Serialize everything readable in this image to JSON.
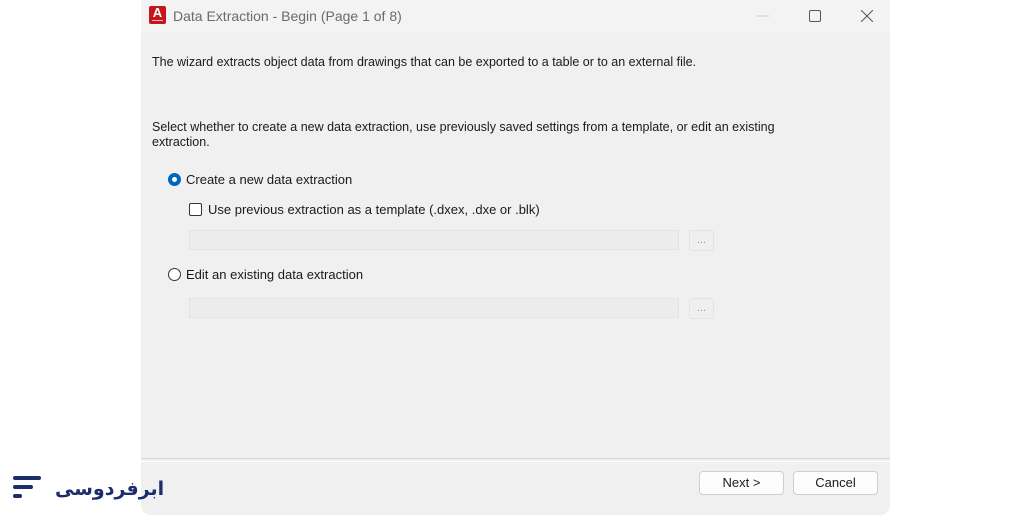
{
  "window": {
    "title": "Data Extraction - Begin (Page 1 of 8)",
    "app_icon_letter": "A"
  },
  "content": {
    "intro": "The wizard extracts object data from drawings that can be exported to a table or to an external file.",
    "instruction": "Select whether to create a new data extraction, use previously saved settings from a template, or edit an existing extraction.",
    "create_new_label": "Create a new data extraction",
    "create_new_selected": true,
    "use_template_label": "Use previous extraction as a template (.dxex, .dxe or .blk)",
    "use_template_checked": false,
    "template_path": "",
    "browse_label": "...",
    "edit_existing_label": "Edit an existing data extraction",
    "edit_existing_selected": false,
    "existing_path": ""
  },
  "footer": {
    "next_label": "Next >",
    "cancel_label": "Cancel"
  },
  "watermark": {
    "text": "ابرفردوسی"
  },
  "colors": {
    "accent": "#0067c0",
    "app_icon": "#c4161c",
    "logo": "#1c2d6b"
  }
}
